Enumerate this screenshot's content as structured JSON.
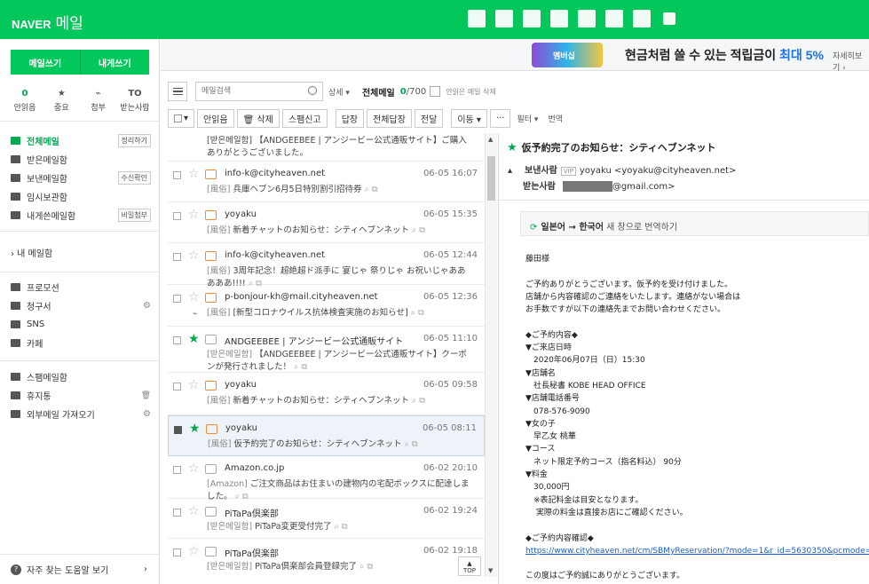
{
  "topbar": {
    "brand": "NAVER",
    "service": "메일"
  },
  "topicons": [
    "mail-icon",
    "calendar-icon",
    "list-icon",
    "contacts-icon",
    "cloud-icon",
    "memo-icon",
    "house-icon",
    "square-icon"
  ],
  "sidebar": {
    "compose": "메일쓰기",
    "self_compose": "내게쓰기",
    "quick": [
      {
        "top": "0",
        "label": "안읽음",
        "icon": "count"
      },
      {
        "top": "★",
        "label": "중요",
        "icon": "star-icon"
      },
      {
        "top": "⌁",
        "label": "첨부",
        "icon": "clip-icon"
      },
      {
        "top": "TO",
        "label": "받는사람",
        "icon": "to-icon"
      }
    ],
    "folders": [
      {
        "label": "전체메일",
        "tag": "정리하기",
        "active": true,
        "icon": "mail-icon"
      },
      {
        "label": "받은메일함",
        "tag": "",
        "icon": "inbox-icon"
      },
      {
        "label": "보낸메일함",
        "tag": "수신확인",
        "icon": "send-icon"
      },
      {
        "label": "임시보관함",
        "tag": "",
        "icon": "folder-icon"
      },
      {
        "label": "내게쓴메일함",
        "tag": "비밀첨부",
        "icon": "self-mail-icon"
      }
    ],
    "my_mailbox": "› 내 메일함",
    "extra": [
      {
        "label": "프로모션",
        "icon": "shop-icon"
      },
      {
        "label": "청구서",
        "gear": true,
        "icon": "bill-icon"
      },
      {
        "label": "SNS",
        "icon": "share-icon"
      },
      {
        "label": "카페",
        "icon": "cafe-icon"
      }
    ],
    "misc": [
      {
        "label": "스팸메일함",
        "icon": "spam-icon"
      },
      {
        "label": "휴지통",
        "count": "52",
        "trash": true,
        "icon": "trash-icon"
      },
      {
        "label": "외부메일 가져오기",
        "gear": true,
        "icon": "import-icon"
      }
    ],
    "help": "자주 찾는 도움말 보기"
  },
  "banner": {
    "badge": "멤버십",
    "text_a": "현금처럼 쓸 수 있는 적립금이 ",
    "text_b": "최대 5%",
    "more": "자세히보기 ›"
  },
  "toolbar": {
    "search_placeholder": "메일검색",
    "detail": "상세 ▾",
    "folder_name": "전체메일",
    "unread": "0",
    "total": "/700",
    "unread_delete": "안읽은 메일 삭제",
    "buttons": [
      "안읽음",
      "🗑 삭제",
      "스팸신고",
      "답장",
      "전체답장",
      "전달",
      "이동 ▾",
      "···"
    ],
    "filter": "필터 ▾",
    "translate": "번역"
  },
  "list": [
    {
      "sender": "",
      "date": "",
      "subject": "[받은메일함] 【ANDGEEBEE | アンジービー公式通販サイト】ご購入ありがとうございました。",
      "starred": false,
      "checked": false,
      "partial": true
    },
    {
      "sender": "info-k@cityheaven.net",
      "date": "06-05 16:07",
      "prefix": "[風俗]",
      "subject": " 兵庫ヘブン6月5日特別割引招待券",
      "starred": false,
      "checked": false
    },
    {
      "sender": "yoyaku",
      "date": "06-05 15:35",
      "prefix": "[風俗]",
      "subject": " 新着チャットのお知らせ：シティヘブンネット",
      "starred": false,
      "checked": false
    },
    {
      "sender": "info-k@cityheaven.net",
      "date": "06-05 12:44",
      "prefix": "[風俗]",
      "subject": " 3周年記念！超絶超ド派手に 宴じゃ 祭りじゃ お祝いじゃあああああ!!!!",
      "starred": false,
      "checked": false
    },
    {
      "sender": "p-bonjour-kh@mail.cityheaven.net",
      "date": "06-05 12:36",
      "prefix": "[風俗]",
      "subject": " [新型コロナウイルス抗体検査実施のお知らせ]",
      "starred": false,
      "checked": false,
      "attach": true
    },
    {
      "sender": "ANDGEEBEE | アンジービー公式通販サイト",
      "date": "06-05 11:10",
      "prefix": "[받은메일함]",
      "subject": " 【ANDGEEBEE | アンジービー公式通販サイト】クーポンが発行されました！",
      "starred": true,
      "checked": false
    },
    {
      "sender": "yoyaku",
      "date": "06-05 09:58",
      "prefix": "[風俗]",
      "subject": " 新着チャットのお知らせ：シティヘブンネット",
      "starred": false,
      "checked": false
    },
    {
      "sender": "yoyaku",
      "date": "06-05 08:11",
      "prefix": "[風俗]",
      "subject": " 仮予約完了のお知らせ：シティヘブンネット",
      "starred": true,
      "checked": true,
      "selected": true
    },
    {
      "sender": "Amazon.co.jp",
      "date": "06-02 20:10",
      "prefix": "[Amazon]",
      "subject": " ご注文商品はお住まいの建物内の宅配ボックスに配達しました。",
      "starred": false,
      "checked": false
    },
    {
      "sender": "PiTaPa倶楽部",
      "date": "06-02 19:24",
      "prefix": "[받은메일함]",
      "subject": " PiTaPa変更受付完了",
      "starred": false,
      "checked": false
    },
    {
      "sender": "PiTaPa倶楽部",
      "date": "06-02 19:18",
      "prefix": "[받은메일함]",
      "subject": " PiTaPa倶楽部会員登録完了",
      "starred": false,
      "checked": false
    }
  ],
  "top_button": "TOP",
  "reader": {
    "title": "仮予約完了のお知らせ：シティヘブンネット",
    "from_label": "보낸사람",
    "vip": "VIP",
    "from": "yoyaku <yoyaku@cityheaven.net>",
    "to_label": "받는사람",
    "to_suffix": "@gmail.com>",
    "translate_lang": "일본어 → 한국어",
    "translate_hint": " 새 창으로 번역하기",
    "body": "藤田様\n\nご予約ありがとうございます。仮予約を受け付けました。\n店舗から内容確認のご連絡をいたします。連絡がない場合は\nお手数ですが以下の連絡先までお問い合わせください。\n\n◆ご予約内容◆\n▼ご来店日時\n　2020年06月07日（日）15:30\n▼店舗名\n　社長秘書 KOBE HEAD OFFICE\n▼店舗電話番号\n　078-576-9090\n▼女の子\n　早乙女 桃華\n▼コース\n　ネット限定予約コース（指名料込） 90分\n▼料金\n　30,000円\n　※表記料金は目安となります。\n　 実際の料金は直接お店にご確認ください。\n\n◆ご予約内容確認◆",
    "link": "https://www.cityheaven.net/cm/SBMyReservation/?mode=1&r_id=5630350&pcmode=sp",
    "closing": "この度はご予約誠にありがとうございます。"
  }
}
